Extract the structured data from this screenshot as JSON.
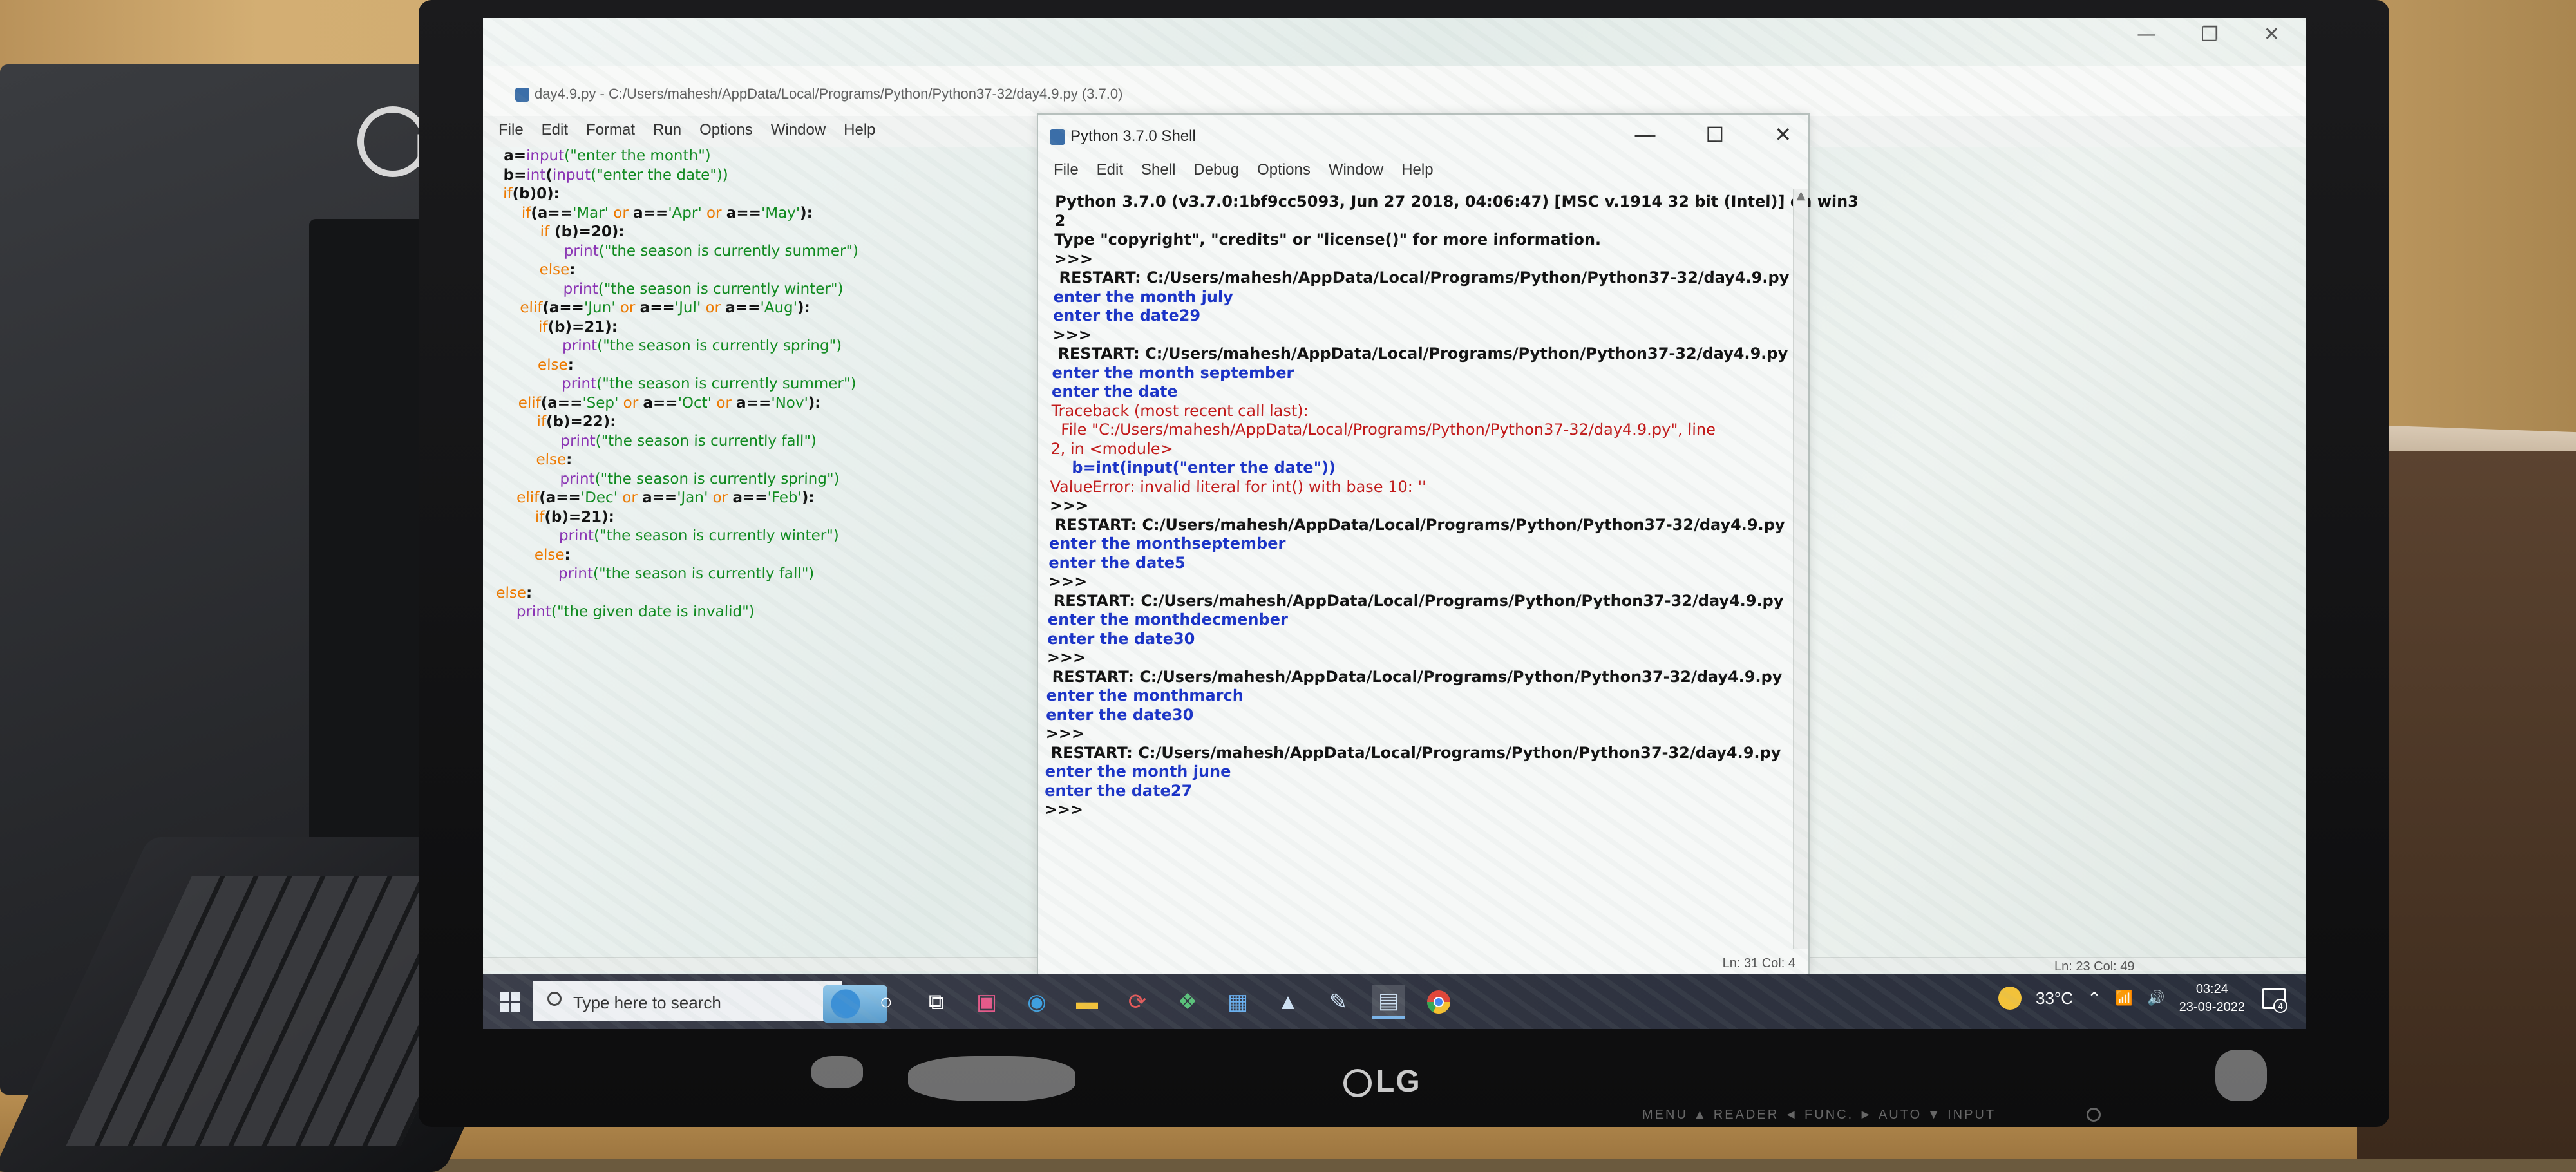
{
  "monitor_brand": "LG",
  "monitor_buttons": "MENU ▲  READER ◄  FUNC. ►  AUTO ▼  INPUT",
  "editor": {
    "title": "day4.9.py - C:/Users/mahesh/AppData/Local/Programs/Python/Python37-32/day4.9.py (3.7.0)",
    "menu": [
      "File",
      "Edit",
      "Format",
      "Run",
      "Options",
      "Window",
      "Help"
    ],
    "status": "Ln: 23   Col: 49",
    "code_lines": [
      [
        {
          "t": "a=",
          "c": "df"
        },
        {
          "t": "input",
          "c": "bi"
        },
        {
          "t": "(\"enter the month\")",
          "c": "str"
        }
      ],
      [
        {
          "t": "b=",
          "c": "df"
        },
        {
          "t": "int",
          "c": "bi"
        },
        {
          "t": "(",
          "c": "df"
        },
        {
          "t": "input",
          "c": "bi"
        },
        {
          "t": "(\"enter the date\"))",
          "c": "str"
        }
      ],
      [
        {
          "t": "if",
          "c": "kw"
        },
        {
          "t": "(b)0):",
          "c": "df"
        }
      ],
      [
        {
          "t": "    if",
          "c": "kw"
        },
        {
          "t": "(a==",
          "c": "df"
        },
        {
          "t": "'Mar'",
          "c": "str"
        },
        {
          "t": " or ",
          "c": "kw"
        },
        {
          "t": "a==",
          "c": "df"
        },
        {
          "t": "'Apr'",
          "c": "str"
        },
        {
          "t": " or ",
          "c": "kw"
        },
        {
          "t": "a==",
          "c": "df"
        },
        {
          "t": "'May'",
          "c": "str"
        },
        {
          "t": "):",
          "c": "df"
        }
      ],
      [
        {
          "t": "        if",
          "c": "kw"
        },
        {
          "t": " (b)=20):",
          "c": "df"
        }
      ],
      [
        {
          "t": "            ",
          "c": "df"
        },
        {
          "t": "print",
          "c": "bi"
        },
        {
          "t": "(\"the season is currently summer\")",
          "c": "str"
        }
      ],
      [
        {
          "t": "        else",
          "c": "kw"
        },
        {
          "t": ":",
          "c": "df"
        }
      ],
      [
        {
          "t": "            ",
          "c": "df"
        },
        {
          "t": "print",
          "c": "bi"
        },
        {
          "t": "(\"the season is currently winter\")",
          "c": "str"
        }
      ],
      [
        {
          "t": "    elif",
          "c": "kw"
        },
        {
          "t": "(a==",
          "c": "df"
        },
        {
          "t": "'Jun'",
          "c": "str"
        },
        {
          "t": " or ",
          "c": "kw"
        },
        {
          "t": "a==",
          "c": "df"
        },
        {
          "t": "'Jul'",
          "c": "str"
        },
        {
          "t": " or ",
          "c": "kw"
        },
        {
          "t": "a==",
          "c": "df"
        },
        {
          "t": "'Aug'",
          "c": "str"
        },
        {
          "t": "):",
          "c": "df"
        }
      ],
      [
        {
          "t": "        if",
          "c": "kw"
        },
        {
          "t": "(b)=21):",
          "c": "df"
        }
      ],
      [
        {
          "t": "            ",
          "c": "df"
        },
        {
          "t": "print",
          "c": "bi"
        },
        {
          "t": "(\"the season is currently spring\")",
          "c": "str"
        }
      ],
      [
        {
          "t": "        else",
          "c": "kw"
        },
        {
          "t": ":",
          "c": "df"
        }
      ],
      [
        {
          "t": "            ",
          "c": "df"
        },
        {
          "t": "print",
          "c": "bi"
        },
        {
          "t": "(\"the season is currently summer\")",
          "c": "str"
        }
      ],
      [
        {
          "t": "    elif",
          "c": "kw"
        },
        {
          "t": "(a==",
          "c": "df"
        },
        {
          "t": "'Sep'",
          "c": "str"
        },
        {
          "t": " or ",
          "c": "kw"
        },
        {
          "t": "a==",
          "c": "df"
        },
        {
          "t": "'Oct'",
          "c": "str"
        },
        {
          "t": " or ",
          "c": "kw"
        },
        {
          "t": "a==",
          "c": "df"
        },
        {
          "t": "'Nov'",
          "c": "str"
        },
        {
          "t": "):",
          "c": "df"
        }
      ],
      [
        {
          "t": "        if",
          "c": "kw"
        },
        {
          "t": "(b)=22):",
          "c": "df"
        }
      ],
      [
        {
          "t": "            ",
          "c": "df"
        },
        {
          "t": "print",
          "c": "bi"
        },
        {
          "t": "(\"the season is currently fall\")",
          "c": "str"
        }
      ],
      [
        {
          "t": "        else",
          "c": "kw"
        },
        {
          "t": ":",
          "c": "df"
        }
      ],
      [
        {
          "t": "            ",
          "c": "df"
        },
        {
          "t": "print",
          "c": "bi"
        },
        {
          "t": "(\"the season is currently spring\")",
          "c": "str"
        }
      ],
      [
        {
          "t": "    elif",
          "c": "kw"
        },
        {
          "t": "(a==",
          "c": "df"
        },
        {
          "t": "'Dec'",
          "c": "str"
        },
        {
          "t": " or ",
          "c": "kw"
        },
        {
          "t": "a==",
          "c": "df"
        },
        {
          "t": "'Jan'",
          "c": "str"
        },
        {
          "t": " or ",
          "c": "kw"
        },
        {
          "t": "a==",
          "c": "df"
        },
        {
          "t": "'Feb'",
          "c": "str"
        },
        {
          "t": "):",
          "c": "df"
        }
      ],
      [
        {
          "t": "        if",
          "c": "kw"
        },
        {
          "t": "(b)=21):",
          "c": "df"
        }
      ],
      [
        {
          "t": "            ",
          "c": "df"
        },
        {
          "t": "print",
          "c": "bi"
        },
        {
          "t": "(\"the season is currently winter\")",
          "c": "str"
        }
      ],
      [
        {
          "t": "        else",
          "c": "kw"
        },
        {
          "t": ":",
          "c": "df"
        }
      ],
      [
        {
          "t": "            ",
          "c": "df"
        },
        {
          "t": "print",
          "c": "bi"
        },
        {
          "t": "(\"the season is currently fall\")",
          "c": "str"
        }
      ],
      [
        {
          "t": "else",
          "c": "kw"
        },
        {
          "t": ":",
          "c": "df"
        }
      ],
      [
        {
          "t": "    ",
          "c": "df"
        },
        {
          "t": "print",
          "c": "bi"
        },
        {
          "t": "(\"the given date is invalid\")",
          "c": "str"
        }
      ]
    ]
  },
  "shell": {
    "title": "Python 3.7.0 Shell",
    "menu": [
      "File",
      "Edit",
      "Shell",
      "Debug",
      "Options",
      "Window",
      "Help"
    ],
    "status": "Ln: 31   Col: 4",
    "lines": [
      {
        "t": "Python 3.7.0 (v3.7.0:1bf9cc5093, Jun 27 2018, 04:06:47) [MSC v.1914 32 bit (Intel)] on win3",
        "c": "sh-out"
      },
      {
        "t": "2",
        "c": "sh-out"
      },
      {
        "t": "Type \"copyright\", \"credits\" or \"license()\" for more information.",
        "c": "sh-out"
      },
      {
        "t": ">>>",
        "c": "sh-out"
      },
      {
        "t": " RESTART: C:/Users/mahesh/AppData/Local/Programs/Python/Python37-32/day4.9.py",
        "c": "sh-out"
      },
      {
        "t": "enter the month july",
        "c": "sh-in"
      },
      {
        "t": "enter the date29",
        "c": "sh-in"
      },
      {
        "t": ">>>",
        "c": "sh-out"
      },
      {
        "t": " RESTART: C:/Users/mahesh/AppData/Local/Programs/Python/Python37-32/day4.9.py",
        "c": "sh-out"
      },
      {
        "t": "enter the month september",
        "c": "sh-in"
      },
      {
        "t": "enter the date",
        "c": "sh-in"
      },
      {
        "t": "Traceback (most recent call last):",
        "c": "sh-err"
      },
      {
        "t": "  File \"C:/Users/mahesh/AppData/Local/Programs/Python/Python37-32/day4.9.py\", line",
        "c": "sh-err"
      },
      {
        "t": "2, in <module>",
        "c": "sh-err"
      },
      {
        "t": "    b=int(input(\"enter the date\"))",
        "c": "sh-in"
      },
      {
        "t": "ValueError: invalid literal for int() with base 10: ''",
        "c": "sh-err"
      },
      {
        "t": ">>>",
        "c": "sh-out"
      },
      {
        "t": " RESTART: C:/Users/mahesh/AppData/Local/Programs/Python/Python37-32/day4.9.py",
        "c": "sh-out"
      },
      {
        "t": "enter the monthseptember",
        "c": "sh-in"
      },
      {
        "t": "enter the date5",
        "c": "sh-in"
      },
      {
        "t": ">>>",
        "c": "sh-out"
      },
      {
        "t": " RESTART: C:/Users/mahesh/AppData/Local/Programs/Python/Python37-32/day4.9.py",
        "c": "sh-out"
      },
      {
        "t": "enter the monthdecmenber",
        "c": "sh-in"
      },
      {
        "t": "enter the date30",
        "c": "sh-in"
      },
      {
        "t": ">>>",
        "c": "sh-out"
      },
      {
        "t": " RESTART: C:/Users/mahesh/AppData/Local/Programs/Python/Python37-32/day4.9.py",
        "c": "sh-out"
      },
      {
        "t": "enter the monthmarch",
        "c": "sh-in"
      },
      {
        "t": "enter the date30",
        "c": "sh-in"
      },
      {
        "t": ">>>",
        "c": "sh-out"
      },
      {
        "t": " RESTART: C:/Users/mahesh/AppData/Local/Programs/Python/Python37-32/day4.9.py",
        "c": "sh-out"
      },
      {
        "t": "enter the month june",
        "c": "sh-in"
      },
      {
        "t": "enter the date27",
        "c": "sh-in"
      },
      {
        "t": ">>>",
        "c": "sh-out"
      }
    ]
  },
  "taskbar": {
    "search_placeholder": "Type here to search",
    "icons": [
      "cortana-circle-icon",
      "task-view-icon",
      "store-bag-icon",
      "edge-icon",
      "file-explorer-icon",
      "sync-icon",
      "network-map-icon",
      "ms-store-icon",
      "photos-icon",
      "paint-icon",
      "idle-icon",
      "chrome-icon"
    ],
    "temperature": "33°C",
    "time": "03:24",
    "date": "23-09-2022",
    "notification_count": "4"
  },
  "colors": {
    "keyword": "#ee7a00",
    "string": "#0f8a1f",
    "builtin": "#8a33b4",
    "shell_input": "#1a33c7",
    "shell_error": "#c21a1a"
  }
}
